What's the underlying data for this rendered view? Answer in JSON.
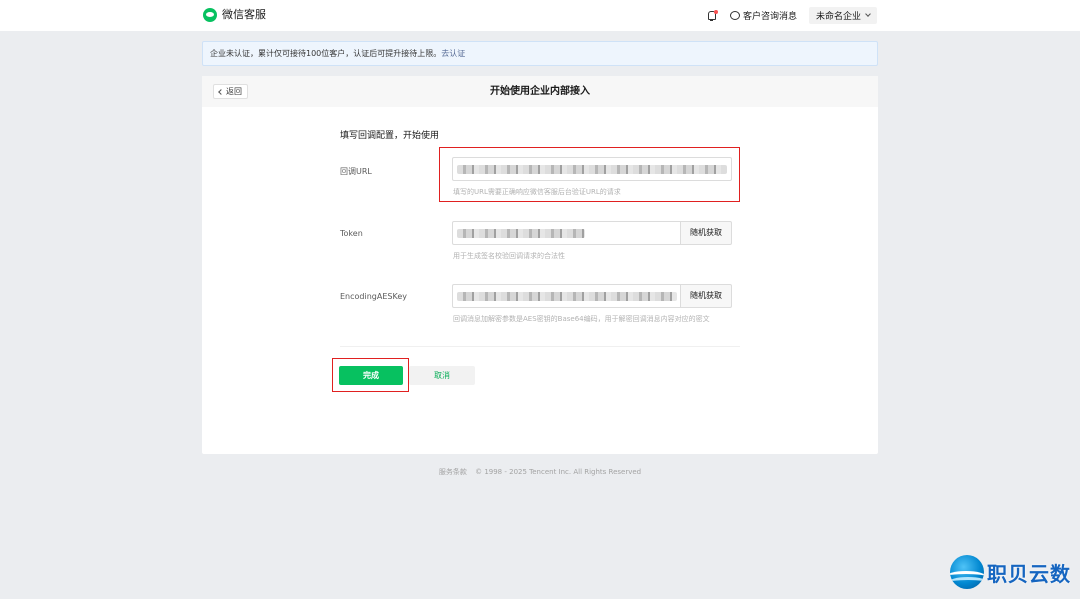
{
  "topbar": {
    "brand_name": "微信客服",
    "messages_label": "客户咨询消息",
    "corp_name": "未命名企业"
  },
  "notice": {
    "text": "企业未认证，累计仅可接待100位客户，认证后可提升接待上限。",
    "link": "去认证"
  },
  "card": {
    "back_label": "返回",
    "title": "开始使用企业内部接入",
    "section_title": "填写回调配置，开始使用",
    "fields": [
      {
        "label": "回调URL",
        "hint": "填写的URL需要正确响应微信客服后台验证URL的请求"
      },
      {
        "label": "Token",
        "button": "随机获取",
        "hint": "用于生成签名校验回调请求的合法性"
      },
      {
        "label": "EncodingAESKey",
        "button": "随机获取",
        "hint": "回调消息加解密参数是AES密钥的Base64编码，用于解密回调消息内容对应的密文"
      }
    ],
    "done_label": "完成",
    "cancel_label": "取消"
  },
  "footer": {
    "terms": "服务条款",
    "copyright": "© 1998 - 2025 Tencent Inc. All Rights Reserved"
  },
  "watermark": {
    "text": "职贝云数"
  },
  "colors": {
    "primary_green": "#07c160",
    "link_blue": "#576b95",
    "highlight_red": "#e02020"
  }
}
